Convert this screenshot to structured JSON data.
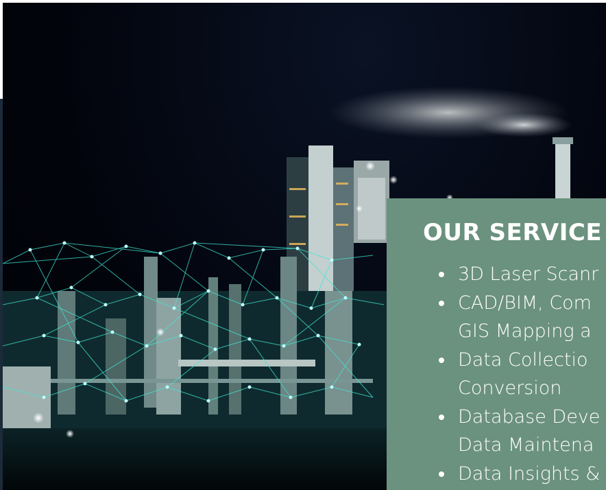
{
  "panel": {
    "title": "OUR SERVICE",
    "services": [
      {
        "lines": [
          "3D Laser Scanr"
        ]
      },
      {
        "lines": [
          "CAD/BIM, Com",
          "GIS Mapping a"
        ]
      },
      {
        "lines": [
          "Data Collectio",
          "Conversion"
        ]
      },
      {
        "lines": [
          "Database Deve",
          "Data Maintena"
        ]
      },
      {
        "lines": [
          "Data Insights &"
        ]
      }
    ]
  },
  "colors": {
    "panel_bg": "#6b917f",
    "night_sky": "#02040c",
    "network_glow": "#3fe8d4"
  }
}
